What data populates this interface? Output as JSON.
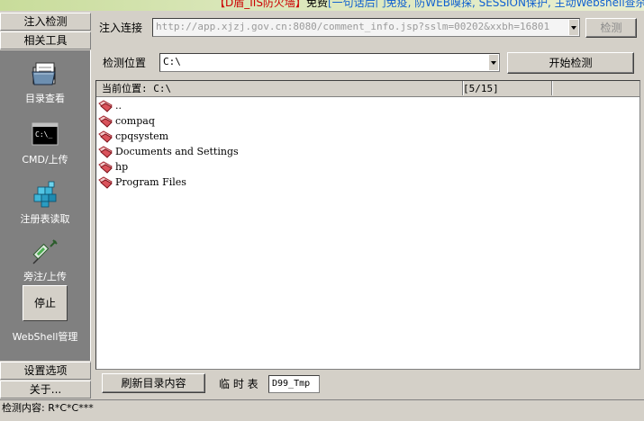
{
  "banner": {
    "part1": "【D盾_IIS防火墙】",
    "part2": "免费",
    "part3": "[一句话后门免疫, 防WEB嗅探, SESSION保护, 主动Webshell查杀]"
  },
  "nav": {
    "inject_detect": "注入检测",
    "related_tools": "相关工具",
    "settings": "设置选项",
    "about": "关于..."
  },
  "tools": [
    {
      "label": "目录查看",
      "icon": "folder-icon"
    },
    {
      "label": "CMD/上传",
      "icon": "cmd-icon"
    },
    {
      "label": "注册表读取",
      "icon": "registry-icon"
    },
    {
      "label": "旁注/上传",
      "icon": "syringe-icon"
    },
    {
      "label": "WebShell管理",
      "icon": "webshell-icon"
    }
  ],
  "stop_label": "停止",
  "inject_url": {
    "label": "注入连接",
    "value": "http://app.xjzj.gov.cn:8080/comment_info.jsp?sslm=00202&xxbh=16801",
    "button": "检测"
  },
  "detect_location": {
    "label": "检测位置",
    "value": "C:\\",
    "button": "开始检测"
  },
  "listview": {
    "col_path": "当前位置: C:\\",
    "col_count": "[5/15]",
    "items": [
      "..",
      "compaq",
      "cpqsystem",
      "Documents and Settings",
      "hp",
      "Program Files"
    ]
  },
  "bottom": {
    "refresh_button": "刷新目录内容",
    "temp_table_label": "临 时 表",
    "temp_table_value": "D99_Tmp"
  },
  "status": {
    "text": "检测内容: R*C*C***"
  },
  "colors": {
    "face": "#d4d0c8",
    "panel": "#808080",
    "banner_red": "#cc0000",
    "banner_blue": "#1060d0"
  }
}
